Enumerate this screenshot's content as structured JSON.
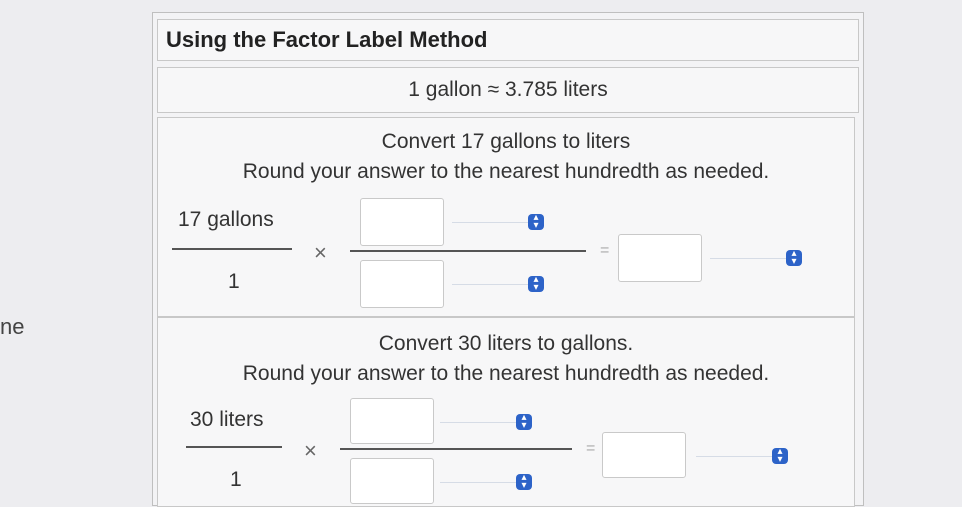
{
  "edge_text": "ne",
  "panel": {
    "title": "Using the Factor Label Method",
    "equivalence": "1 gallon  ≈  3.785 liters"
  },
  "problem1": {
    "instruction": "Convert 17 gallons to liters",
    "rounding": "Round your answer to the nearest hundredth as needed.",
    "numerator": "17 gallons",
    "denominator": "1",
    "times": "×",
    "equals": "="
  },
  "problem2": {
    "instruction": "Convert 30 liters to gallons.",
    "rounding": "Round your answer to the nearest hundredth as needed.",
    "numerator": "30 liters",
    "denominator": "1",
    "times": "×",
    "equals": "="
  },
  "icons": {
    "unit_dropdown": "up-down-chevron-icon"
  },
  "colors": {
    "accent": "#2d63c8"
  }
}
